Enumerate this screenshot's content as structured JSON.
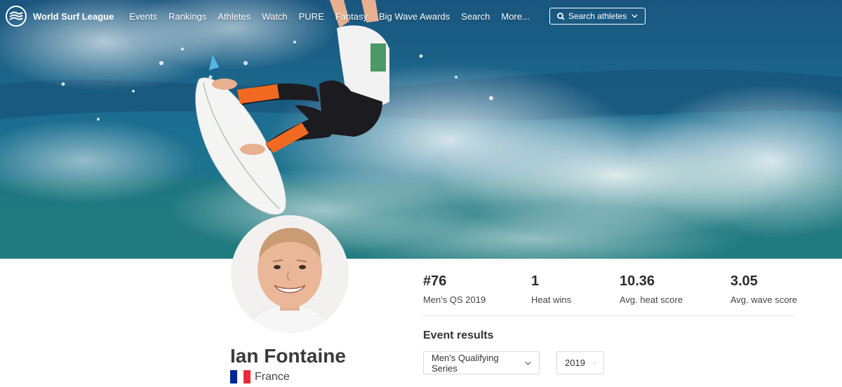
{
  "brand": {
    "name": "World Surf League"
  },
  "nav": {
    "items": [
      "Events",
      "Rankings",
      "Athletes",
      "Watch",
      "PURE",
      "Fantasy",
      "Big Wave Awards",
      "Search",
      "More..."
    ],
    "search": {
      "label": "Search athletes",
      "icon": "search-icon"
    }
  },
  "athlete": {
    "name": "Ian Fontaine",
    "country": "France",
    "flag_colors": [
      "#002395",
      "#ffffff",
      "#ed2939"
    ]
  },
  "stats": [
    {
      "value": "#76",
      "label": "Men's QS 2019"
    },
    {
      "value": "1",
      "label": "Heat wins"
    },
    {
      "value": "10.36",
      "label": "Avg. heat score"
    },
    {
      "value": "3.05",
      "label": "Avg. wave score"
    }
  ],
  "event_results": {
    "title": "Event results",
    "series_select": "Men's Qualifying Series",
    "year_select": "2019"
  },
  "colors": {
    "ocean": "#1d6c8f",
    "wetsuit_accent": "#f26a21",
    "text_dark": "#2c2c2c"
  }
}
